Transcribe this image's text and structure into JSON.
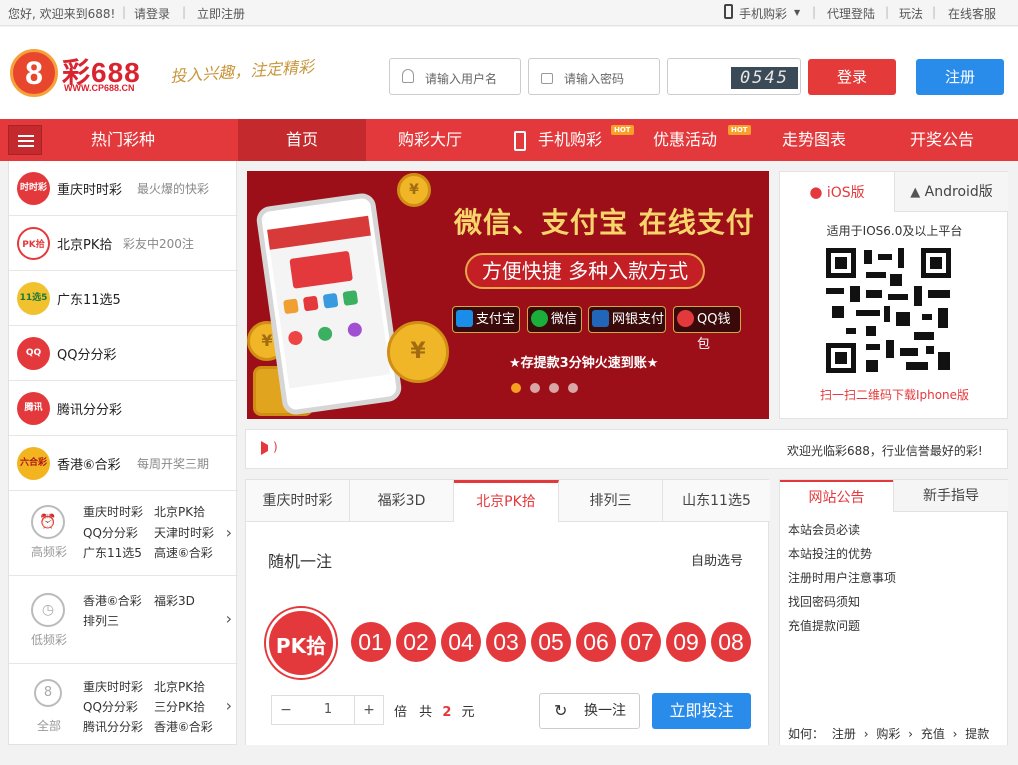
{
  "topbar": {
    "welcome": "您好, 欢迎来到688!",
    "login": "请登录",
    "register": "立即注册",
    "mobile": "手机购彩",
    "agent": "代理登陆",
    "howto": "玩法",
    "service": "在线客服"
  },
  "header": {
    "logo_mark": "8",
    "logo_text": "彩688",
    "logo_url": "WWW.CP688.CN",
    "slogan": "投入兴趣，注定精彩",
    "username_placeholder": "请输入用户名",
    "password_placeholder": "请输入密码",
    "captcha": "0545",
    "login_btn": "登录",
    "register_btn": "注册"
  },
  "nav": {
    "hot_lottery": "热门彩种",
    "items": [
      "首页",
      "购彩大厅",
      "手机购彩",
      "优惠活动",
      "走势图表",
      "开奖公告"
    ],
    "hot_badge": "HOT"
  },
  "sidebar": {
    "lotteries": [
      {
        "icon": "时时彩",
        "name": "重庆时时彩",
        "desc": "最火爆的快彩"
      },
      {
        "icon": "PK拾",
        "name": "北京PK拾",
        "desc": "彩友中200注"
      },
      {
        "icon": "11选5",
        "name": "广东11选5",
        "desc": ""
      },
      {
        "icon": "QQ",
        "name": "QQ分分彩",
        "desc": ""
      },
      {
        "icon": "腾讯",
        "name": "腾讯分分彩",
        "desc": ""
      },
      {
        "icon": "六合彩",
        "name": "香港⑥合彩",
        "desc": "每周开奖三期"
      }
    ],
    "groups": [
      {
        "label": "高频彩",
        "icon": "⏰",
        "items": [
          "重庆时时彩",
          "北京PK拾",
          "QQ分分彩",
          "天津时时彩",
          "广东11选5",
          "高速⑥合彩"
        ]
      },
      {
        "label": "低频彩",
        "icon": "◷",
        "items": [
          "香港⑥合彩",
          "福彩3D",
          "排列三"
        ]
      },
      {
        "label": "全部",
        "icon": "8",
        "items": [
          "重庆时时彩",
          "北京PK拾",
          "QQ分分彩",
          "三分PK拾",
          "腾讯分分彩",
          "香港⑥合彩"
        ]
      }
    ]
  },
  "banner": {
    "title": "微信、支付宝 在线支付",
    "subtitle": "方便快捷 多种入款方式",
    "pay_methods": [
      "支付宝",
      "微信",
      "网银支付",
      "QQ钱包"
    ],
    "note": "★存提款3分钟火速到账★",
    "coin_mark": "¥",
    "active_slide": 1,
    "slide_count": 4
  },
  "app": {
    "ios_tab": "iOS版",
    "android_tab": "Android版",
    "note": "适用于IOS6.0及以上平台",
    "scan": "扫一扫二维码下载Iphone版"
  },
  "marquee": {
    "text": "欢迎光临彩688，行业信誉最好的彩!"
  },
  "picker": {
    "tabs": [
      "重庆时时彩",
      "福彩3D",
      "北京PK拾",
      "排列三",
      "山东11选5"
    ],
    "active_tab": 2,
    "random_label": "随机一注",
    "self_pick": "自助选号",
    "logo": "PK拾",
    "balls": [
      "01",
      "02",
      "04",
      "03",
      "05",
      "06",
      "07",
      "09",
      "08"
    ],
    "minus": "−",
    "qty": "1",
    "plus": "+",
    "multiple": "倍",
    "total_prefix": "共",
    "total_amount": "2",
    "currency": "元",
    "swap_btn": "换一注",
    "bet_btn": "立即投注"
  },
  "notice": {
    "tab_notice": "网站公告",
    "tab_guide": "新手指导",
    "items": [
      "本站会员必读",
      "本站投注的优势",
      "注册时用户注意事项",
      "找回密码须知",
      "充值提款问题"
    ],
    "howto_label": "如何：",
    "steps": [
      "注册",
      "购彩",
      "充值",
      "提款"
    ]
  },
  "colors": {
    "brand_red": "#e4393c",
    "button_blue": "#2a8cea",
    "banner_red": "#9c0f18"
  }
}
